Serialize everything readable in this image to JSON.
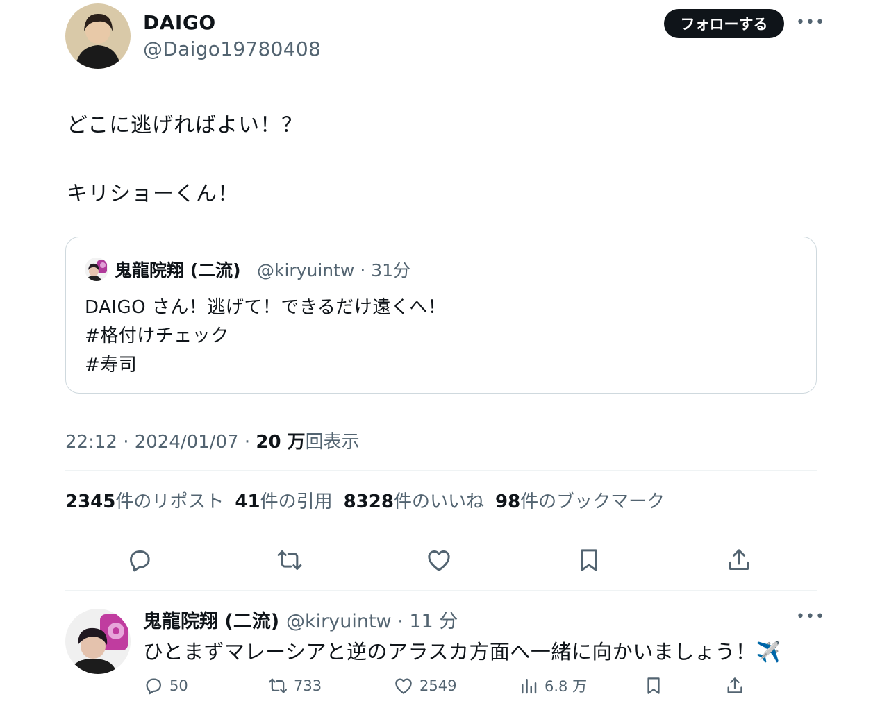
{
  "author": {
    "display_name": "DAIGO",
    "handle": "@Daigo19780408",
    "follow_label": "フォローする",
    "more_label": "•••"
  },
  "tweet": {
    "line1": "どこに逃げればよい！？",
    "line2": "キリショーくん！"
  },
  "quote": {
    "name": "鬼龍院翔 (二流)",
    "handle_time": "@kiryuintw · 31分",
    "line1": "DAIGO さん！逃げて！できるだけ遠くへ！",
    "line2": "#格付けチェック",
    "line3": "#寿司"
  },
  "meta": {
    "time_date": "22:12 · 2024/01/07 · ",
    "views_num": "20 万",
    "views_label": "回表示"
  },
  "stats": {
    "reposts_num": "2345",
    "reposts_label": "件のリポスト",
    "quotes_num": "41",
    "quotes_label": "件の引用",
    "likes_num": "8328",
    "likes_label": "件のいいね",
    "bookmarks_num": "98",
    "bookmarks_label": "件のブックマーク"
  },
  "actions": [
    "reply-icon",
    "repost-icon",
    "like-icon",
    "bookmark-icon",
    "share-icon"
  ],
  "reply": {
    "name": "鬼龍院翔 (二流)",
    "handle_time": "@kiryuintw · 11 分",
    "text": "ひとまずマレーシアと逆のアラスカ方面へ一緒に向かいましょう！✈️",
    "more_label": "•••",
    "reply_count": "50",
    "repost_count": "733",
    "like_count": "2549",
    "view_count": "6.8 万"
  },
  "colors": {
    "text": "#0f1419",
    "muted": "#536471",
    "border": "#cfd9de",
    "divider": "#eff3f4",
    "button_bg": "#0f1419"
  }
}
